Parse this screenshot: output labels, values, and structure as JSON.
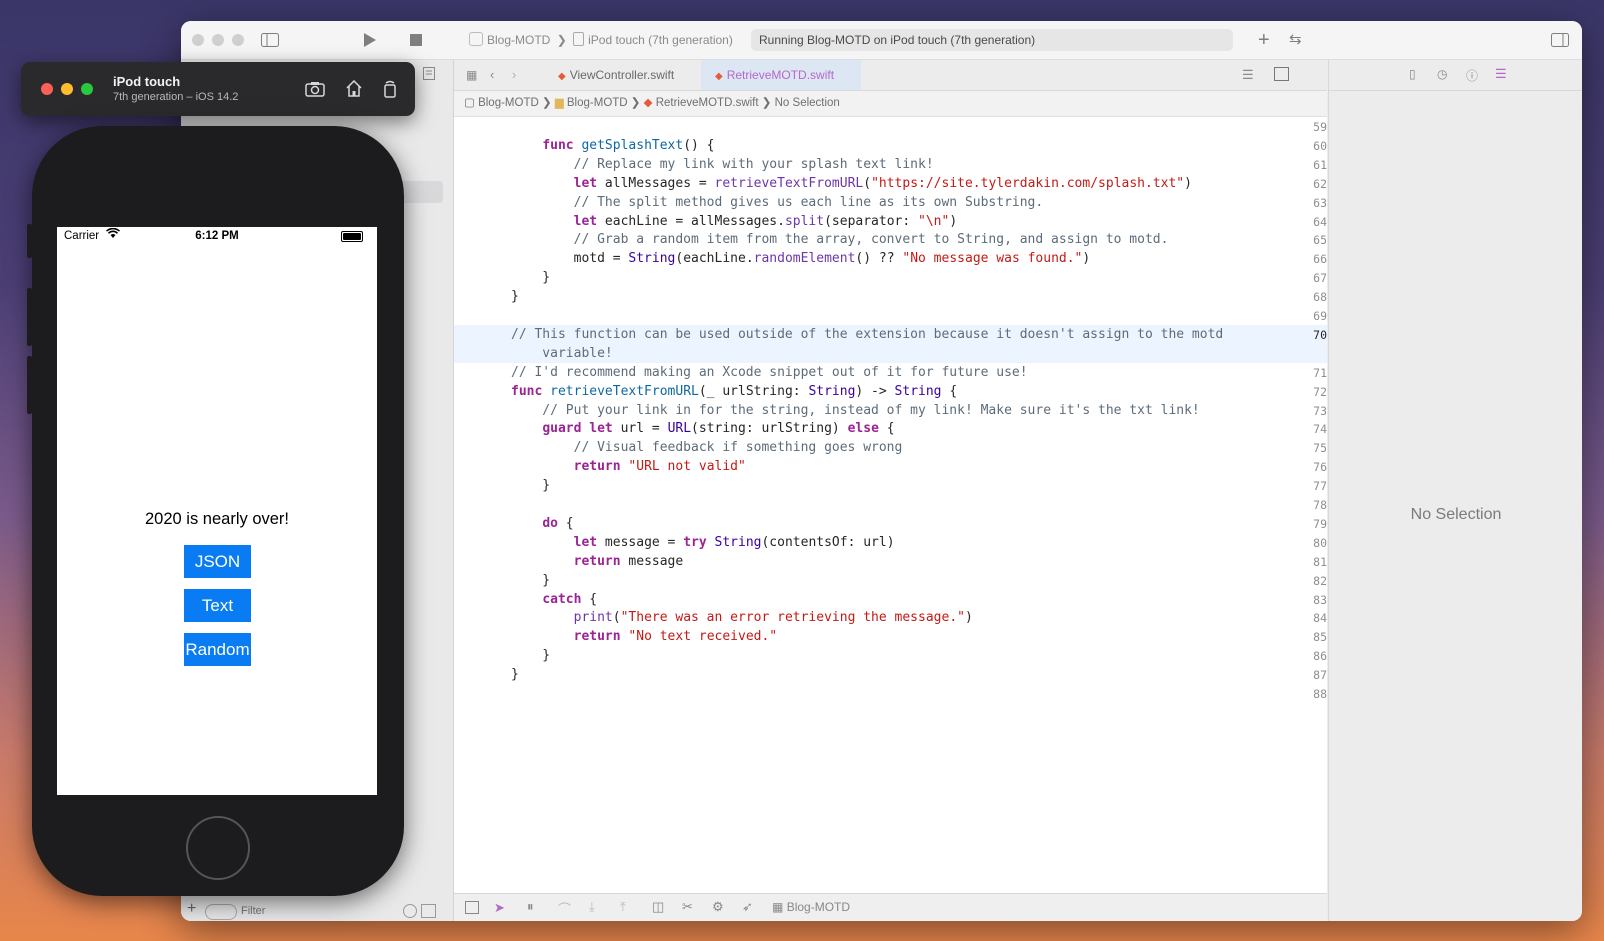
{
  "xcode": {
    "scheme": "Blog-MOTD",
    "destination": "iPod touch (7th generation)",
    "status": "Running Blog-MOTD on iPod touch (7th generation)",
    "tabs": [
      {
        "label": "ViewController.swift",
        "active": false
      },
      {
        "label": "RetrieveMOTD.swift",
        "active": true
      }
    ],
    "jumpbar": [
      "Blog-MOTD",
      "Blog-MOTD",
      "RetrieveMOTD.swift",
      "No Selection"
    ],
    "navigator_filter_placeholder": "Filter",
    "debug_target": "Blog-MOTD",
    "inspector_empty": "No Selection",
    "highlighted_line": 70,
    "code_lines": [
      {
        "n": "59",
        "text": ""
      },
      {
        "n": "60",
        "text": "    func getSplashText() {"
      },
      {
        "n": "61",
        "text": "        // Replace my link with your splash text link!"
      },
      {
        "n": "62",
        "text": "        let allMessages = retrieveTextFromURL(\"https://site.tylerdakin.com/splash.txt\")"
      },
      {
        "n": "63",
        "text": "        // The split method gives us each line as its own Substring."
      },
      {
        "n": "64",
        "text": "        let eachLine = allMessages.split(separator: \"\\n\")"
      },
      {
        "n": "65",
        "text": "        // Grab a random item from the array, convert to String, and assign to motd."
      },
      {
        "n": "66",
        "text": "        motd = String(eachLine.randomElement() ?? \"No message was found.\")"
      },
      {
        "n": "67",
        "text": "    }"
      },
      {
        "n": "68",
        "text": "}"
      },
      {
        "n": "69",
        "text": ""
      },
      {
        "n": "70",
        "text": "// This function can be used outside of the extension because it doesn't assign to the motd"
      },
      {
        "n": "",
        "text": "    variable!"
      },
      {
        "n": "71",
        "text": "// I'd recommend making an Xcode snippet out of it for future use!"
      },
      {
        "n": "72",
        "text": "func retrieveTextFromURL(_ urlString: String) -> String {"
      },
      {
        "n": "73",
        "text": "    // Put your link in for the string, instead of my link! Make sure it's the txt link!"
      },
      {
        "n": "74",
        "text": "    guard let url = URL(string: urlString) else {"
      },
      {
        "n": "75",
        "text": "        // Visual feedback if something goes wrong"
      },
      {
        "n": "76",
        "text": "        return \"URL not valid\""
      },
      {
        "n": "77",
        "text": "    }"
      },
      {
        "n": "78",
        "text": ""
      },
      {
        "n": "79",
        "text": "    do {"
      },
      {
        "n": "80",
        "text": "        let message = try String(contentsOf: url)"
      },
      {
        "n": "81",
        "text": "        return message"
      },
      {
        "n": "82",
        "text": "    }"
      },
      {
        "n": "83",
        "text": "    catch {"
      },
      {
        "n": "84",
        "text": "        print(\"There was an error retrieving the message.\")"
      },
      {
        "n": "85",
        "text": "        return \"No text received.\""
      },
      {
        "n": "86",
        "text": "    }"
      },
      {
        "n": "87",
        "text": "}"
      },
      {
        "n": "88",
        "text": ""
      }
    ]
  },
  "simulator": {
    "title": "iPod touch",
    "subtitle": "7th generation – iOS 14.2",
    "carrier": "Carrier",
    "time": "6:12 PM",
    "motd": "2020 is nearly over!",
    "buttons": [
      "JSON",
      "Text",
      "Random"
    ]
  },
  "colors": {
    "ios_button": "#0a7cf3",
    "keyword": "#9b2393",
    "string": "#c41a16",
    "comment": "#5d6c79",
    "active_tab": "#b469c9"
  },
  "icons": {
    "navigator_toggle": "sidebar-icon",
    "run": "play-icon",
    "stop": "stop-icon",
    "library": "plus-icon",
    "inspector_toggle": "sidebar-right-icon",
    "screenshot": "camera-icon",
    "home": "home-icon",
    "rotate": "rotate-icon"
  }
}
